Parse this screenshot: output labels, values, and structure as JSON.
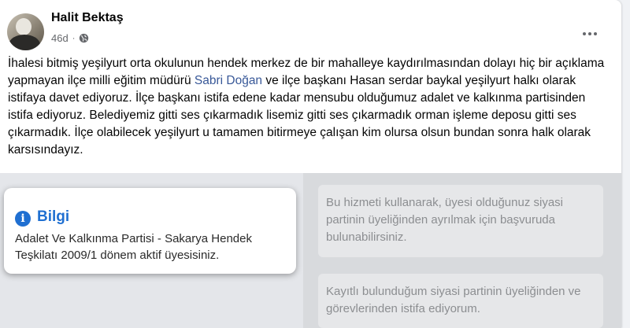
{
  "post": {
    "author": "Halit Bektaş",
    "time": "46d",
    "separator": "·",
    "visibility_icon": "globe-icon",
    "more_icon": "more-options-icon",
    "text_before_mention": "İhalesi bitmiş yeşilyurt orta okulunun hendek merkez de bir mahalleye kaydırılmasından dolayı hiç bir açıklama yapmayan ilçe milli eğitim müdürü ",
    "mention": "Sabri Doğan",
    "text_after_mention": "  ve ilçe başkanı Hasan serdar baykal yeşilyurt halkı olarak istifaya davet ediyoruz. İlçe başkanı istifa edene kadar mensubu olduğumuz adalet ve kalkınma partisinden istifa ediyoruz. Belediyemiz gitti ses çıkarmadık lisemiz gitti ses çıkarmadık orman işleme deposu gitti ses çıkarmadık. İlçe olabilecek yeşilyurt u tamamen bitirmeye çalışan kim olursa olsun bundan sonra halk olarak karsısındayız."
  },
  "attachment": {
    "info_card": {
      "icon": "info-icon",
      "icon_glyph": "i",
      "title": "Bilgi",
      "text": "Adalet Ve Kalkınma Partisi - Sakarya Hendek Teşkilatı 2009/1 dönem aktif üyesisiniz."
    },
    "notice_1": "Bu hizmeti kullanarak, üyesi olduğunuz siyasi partinin üyeliğinden ayrılmak için başvuruda bulunabilirsiniz.",
    "notice_2": "Kayıtlı bulunduğum siyasi partinin üyeliğinden ve görevlerinden istifa ediyorum."
  },
  "colors": {
    "mention": "#385898",
    "info_blue": "#1f6fd1",
    "secondary_text": "#65676b"
  }
}
